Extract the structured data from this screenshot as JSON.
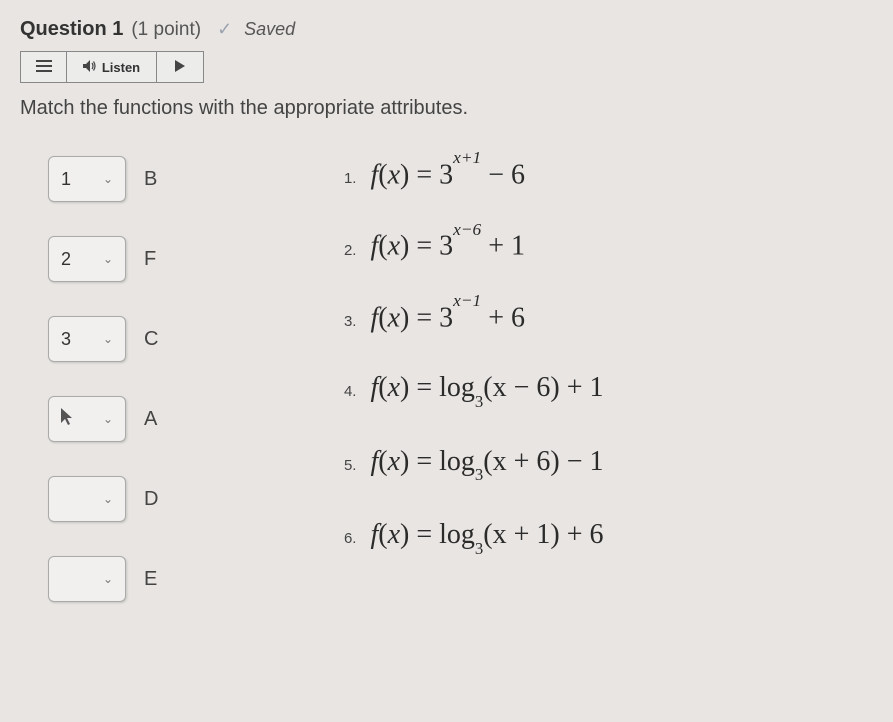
{
  "header": {
    "question_label": "Question 1",
    "points": "(1 point)",
    "saved_label": "Saved"
  },
  "toolbar": {
    "listen_label": "Listen"
  },
  "prompt": "Match the functions with the appropriate attributes.",
  "matches": [
    {
      "selected": "1",
      "letter": "B"
    },
    {
      "selected": "2",
      "letter": "F"
    },
    {
      "selected": "3",
      "letter": "C"
    },
    {
      "selected": "cursor",
      "letter": "A"
    },
    {
      "selected": "",
      "letter": "D"
    },
    {
      "selected": "",
      "letter": "E"
    }
  ],
  "functions": [
    {
      "num": "1.",
      "base": "3",
      "exp": "x+1",
      "tail": " − 6",
      "type": "exp"
    },
    {
      "num": "2.",
      "base": "3",
      "exp": "x−6",
      "tail": " + 1",
      "type": "exp"
    },
    {
      "num": "3.",
      "base": "3",
      "exp": "x−1",
      "tail": " + 6",
      "type": "exp"
    },
    {
      "num": "4.",
      "logbase": "3",
      "arg": "(x − 6)",
      "tail": " + 1",
      "type": "log"
    },
    {
      "num": "5.",
      "logbase": "3",
      "arg": "(x + 6)",
      "tail": " − 1",
      "type": "log"
    },
    {
      "num": "6.",
      "logbase": "3",
      "arg": "(x + 1)",
      "tail": " + 6",
      "type": "log"
    }
  ]
}
